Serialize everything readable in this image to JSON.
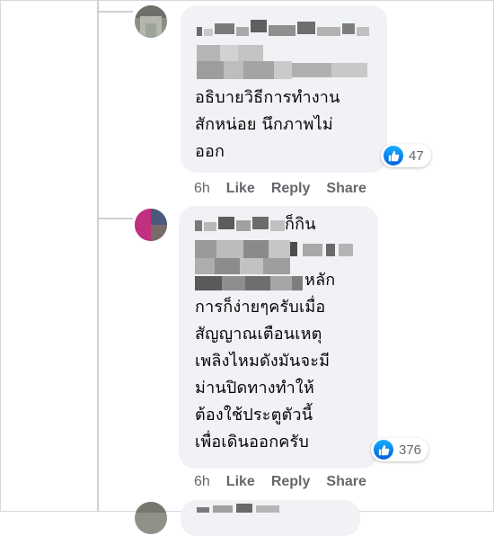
{
  "comments": [
    {
      "text": "อธิบายวิธีการทำงาน\nสักหน่อย นึกภาพไม่\nออก",
      "reaction_icon": "like-icon",
      "reaction_count": "47",
      "time": "6h",
      "like_label": "Like",
      "reply_label": "Reply",
      "share_label": "Share"
    },
    {
      "partial_line_1": "ก็กิน",
      "partial_line_3": "หลัก",
      "text": "การก็ง่ายๆครับเมื่อ\nสัญญาณเตือนเหตุ\nเพลิงไหมดังมันจะมี\nม่านปิดทางทำให้\nต้องใช้ประตูตัวนี้\nเพื่อเดินออกครับ",
      "reaction_icon": "like-icon",
      "reaction_count": "376",
      "time": "6h",
      "like_label": "Like",
      "reply_label": "Reply",
      "share_label": "Share"
    }
  ],
  "colors": {
    "bubble": "#f0f2f5",
    "secondary_text": "#65676b",
    "like_blue": "#0866ff",
    "thread_line": "#ced0d4"
  }
}
